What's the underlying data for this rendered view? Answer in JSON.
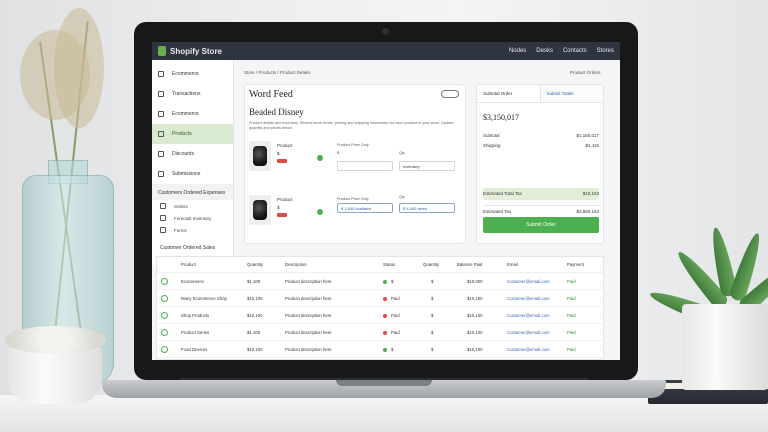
{
  "app": {
    "name": "Shopify Store",
    "nav_right": [
      "Nodes",
      "Desks",
      "Contacts",
      "Stores"
    ]
  },
  "sidebar": {
    "items": [
      {
        "label": "Ecommerce"
      },
      {
        "label": "Transactions"
      },
      {
        "label": "Ecommerce"
      },
      {
        "label": "Products",
        "active": true
      },
      {
        "label": "Discounts"
      },
      {
        "label": "Submissions"
      }
    ],
    "group_label": "Customers Ordered Expenses",
    "subitems": [
      {
        "label": "Orders"
      },
      {
        "label": "Forecast Inventory"
      },
      {
        "label": "Forms"
      }
    ]
  },
  "breadcrumb": "Store / Products / Product Details",
  "breadcrumb_right": "Product Orders",
  "main": {
    "title": "Word Feed",
    "subtitle": "Beaded Disney",
    "description": "Product details and inventory. Review stock levels, pricing and shipping information for each product in your store. Update quantity and prices below.",
    "products": [
      {
        "name": "Product",
        "price": "$",
        "tag_color": "#e04848",
        "field1_label": "Product Price Only",
        "field1_value": "$",
        "field2_label": "Qty",
        "field2_value": "Inventory"
      },
      {
        "name": "Product",
        "price": "$",
        "tag_color": "#e04848",
        "field1_label": "Product Price Only",
        "field1_value": "$ 1,500 Available",
        "field2_label": "Qty",
        "field2_value": "$ 4,500 Items"
      }
    ]
  },
  "summary": {
    "tabs": [
      "Subtotal Order",
      "Submit Totals"
    ],
    "total": "$3,150,017",
    "rows": [
      {
        "label": "Subtotal",
        "value": "$1,150,017"
      },
      {
        "label": "Shipping",
        "value": "$1,115"
      },
      {
        "label": "Estimated Total Tax",
        "value": "$10,153"
      }
    ],
    "tax_label": "Estimated Tax",
    "tax_value": "$3,850,153",
    "button": "Submit Order"
  },
  "orders": {
    "title": "Customer Ordered Sales",
    "columns": [
      "Product",
      "Quantity",
      "Description",
      "Status",
      "Quantity",
      "Balance Paid",
      "Email",
      "Payment"
    ],
    "rows": [
      {
        "product": "Ecommerce",
        "qty": "$1,100",
        "desc": "Product description here",
        "status_color": "#4caf50",
        "status": "$",
        "count": "$",
        "paid": "$10,000",
        "email": "Customer@email.com",
        "payment": "Paid"
      },
      {
        "product": "Many Ecommerce Shop",
        "qty": "$10,100",
        "desc": "Product description here",
        "status_color": "#e04848",
        "status": "Paid",
        "count": "$",
        "paid": "$10,100",
        "email": "Customer@email.com",
        "payment": "Paid"
      },
      {
        "product": "Shop Products",
        "qty": "$10,100",
        "desc": "Product description here",
        "status_color": "#e04848",
        "status": "Paid",
        "count": "$",
        "paid": "$10,100",
        "email": "Customer@email.com",
        "payment": "Paid"
      },
      {
        "product": "Product Series",
        "qty": "$1,100",
        "desc": "Product description here",
        "status_color": "#e04848",
        "status": "Paid",
        "count": "$",
        "paid": "$10,100",
        "email": "Customer@email.com",
        "payment": "Paid"
      },
      {
        "product": "Food Devices",
        "qty": "$10,100",
        "desc": "Product description here",
        "status_color": "#4caf50",
        "status": "$",
        "count": "$",
        "paid": "$10,100",
        "email": "Customer@email.com",
        "payment": "Paid"
      }
    ]
  }
}
